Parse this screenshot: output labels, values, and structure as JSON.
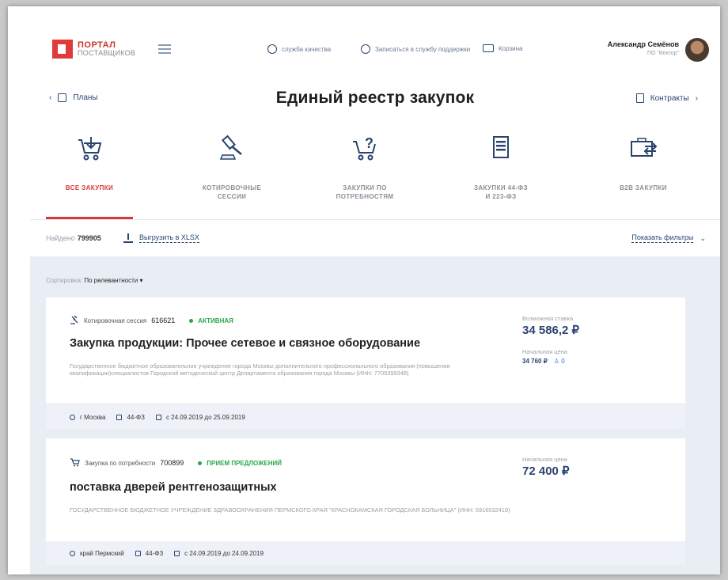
{
  "header": {
    "logo_line1": "ПОРТАЛ",
    "logo_line2": "ПОСТАВЩИКОВ",
    "links": [
      {
        "label": "служба качества",
        "icon": "headset-icon"
      },
      {
        "label": "Записаться в службу поддержки",
        "icon": "info-icon"
      },
      {
        "label": "Корзина",
        "icon": "cart-icon"
      }
    ],
    "user_name": "Александр Семёнов",
    "user_org": "ПО \"Вектор\""
  },
  "nav": {
    "back_label": "Планы",
    "title": "Единый реестр закупок",
    "forward_label": "Контракты"
  },
  "tabs": [
    {
      "label": "ВСЕ ЗАКУПКИ",
      "icon": "cart-download-icon",
      "active": true
    },
    {
      "label": "КОТИРОВОЧНЫЕ\nСЕССИИ",
      "icon": "gavel-icon",
      "active": false
    },
    {
      "label": "ЗАКУПКИ ПО\nПОТРЕБНОСТЯМ",
      "icon": "cart-question-icon",
      "active": false
    },
    {
      "label": "ЗАКУПКИ 44-ФЗ\nИ 223-ФЗ",
      "icon": "list-document-icon",
      "active": false
    },
    {
      "label": "B2B ЗАКУПКИ",
      "icon": "briefcase-exchange-icon",
      "active": false
    }
  ],
  "results": {
    "found_label": "Найдено",
    "found_count": "799905",
    "export_label": "Выгрузить в XLSX",
    "filters_label": "Показать фильтры",
    "sort_label": "Сортировка:",
    "sort_value": "По релевантности"
  },
  "cards": [
    {
      "type_label": "Котировочная сессия",
      "number": "616621",
      "status": "АКТИВНАЯ",
      "title": "Закупка продукции: Прочее сетевое и связное оборудование",
      "org": "Государственное бюджетное образовательное учреждение города Москвы дополнительного профессионального образования (повышения квалификации)специалистов Городской методический центр Департамента образования города Москвы (ИНН: 7705399348)",
      "price_label": "Возможная ставка",
      "price": "34 586,2 ₽",
      "start_label": "Начальная цена",
      "start_price": "34 760 ₽",
      "bids": "0",
      "region": "г Москва",
      "law": "44-ФЗ",
      "dates": "с 24.09.2019 до 25.09.2019"
    },
    {
      "type_label": "Закупка по потребности",
      "number": "700899",
      "status": "ПРИЕМ ПРЕДЛОЖЕНИЙ",
      "title": "поставка дверей рентгенозащитных",
      "org": "ГОСУДАРСТВЕННОЕ БЮДЖЕТНОЕ УЧРЕЖДЕНИЕ ЗДРАВООХРАНЕНИЯ ПЕРМСКОГО КРАЯ \"КРАСНОКАМСКАЯ ГОРОДСКАЯ БОЛЬНИЦА\" (ИНН: 5916032419)",
      "price_label": "Начальная цена",
      "price": "72 400 ₽",
      "region": "край Пермский",
      "law": "44-ФЗ",
      "dates": "с 24.09.2019 до 24.09.2019"
    }
  ],
  "colors": {
    "accent_red": "#d6383a",
    "navy": "#2a4470",
    "status_green": "#29a74a",
    "list_bg": "#e9eef5"
  }
}
